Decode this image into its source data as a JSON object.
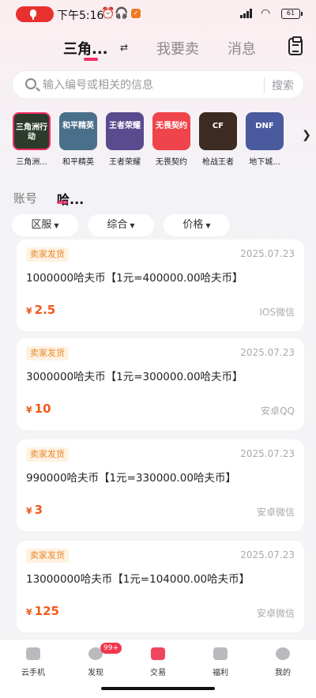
{
  "status_bar": {
    "time": "下午5:16",
    "battery": "61"
  },
  "top_tabs": [
    {
      "label": "三角..."
    },
    {
      "label": "我要卖"
    },
    {
      "label": "消息"
    }
  ],
  "search": {
    "placeholder": "输入编号或相关的信息",
    "button": "搜索"
  },
  "games": [
    {
      "label": "三角洲...",
      "thumb_text": "三角洲行动",
      "color": "#2c3b2c"
    },
    {
      "label": "和平精英",
      "thumb_text": "和平精英",
      "color": "#4a6f8a"
    },
    {
      "label": "王者荣耀",
      "thumb_text": "王者荣耀",
      "color": "#5a4a8e"
    },
    {
      "label": "无畏契约",
      "thumb_text": "无畏契约",
      "color": "#f0444c"
    },
    {
      "label": "枪战王者",
      "thumb_text": "CF",
      "color": "#3d2a22"
    },
    {
      "label": "地下城...",
      "thumb_text": "DNF",
      "color": "#4a5a9e"
    }
  ],
  "category": {
    "account": "账号",
    "active": "哈..."
  },
  "filters": [
    {
      "label": "区服"
    },
    {
      "label": "综合"
    },
    {
      "label": "价格"
    }
  ],
  "listings": [
    {
      "tag": "卖家发货",
      "date": "2025.07.23",
      "title": "1000000哈夫币【1元=400000.00哈夫币】",
      "currency": "¥",
      "price": "2.5",
      "platform": "IOS微信"
    },
    {
      "tag": "卖家发货",
      "date": "2025.07.23",
      "title": "3000000哈夫币【1元=300000.00哈夫币】",
      "currency": "¥",
      "price": "10",
      "platform": "安卓QQ"
    },
    {
      "tag": "卖家发货",
      "date": "2025.07.23",
      "title": "990000哈夫币【1元=330000.00哈夫币】",
      "currency": "¥",
      "price": "3",
      "platform": "安卓微信"
    },
    {
      "tag": "卖家发货",
      "date": "2025.07.23",
      "title": "13000000哈夫币【1元=104000.00哈夫币】",
      "currency": "¥",
      "price": "125",
      "platform": "安卓微信"
    }
  ],
  "bottom_nav": [
    {
      "label": "云手机"
    },
    {
      "label": "发现",
      "badge": "99+"
    },
    {
      "label": "交易",
      "active": true
    },
    {
      "label": "福利"
    },
    {
      "label": "我的"
    }
  ]
}
